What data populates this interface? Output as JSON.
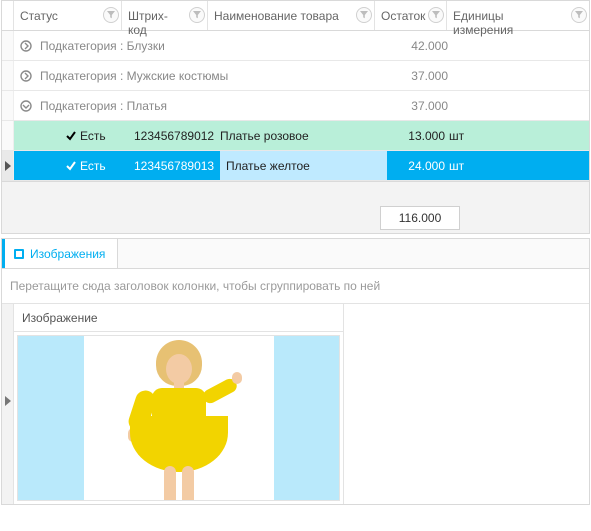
{
  "grid": {
    "columns": {
      "status": "Статус",
      "barcode": "Штрих-код",
      "name": "Наименование товара",
      "stock": "Остаток",
      "uom": "Единицы измерения"
    },
    "groups": [
      {
        "label": "Подкатегория : Блузки",
        "stock": "42.000",
        "expanded": false
      },
      {
        "label": "Подкатегория : Мужские костюмы",
        "stock": "37.000",
        "expanded": false
      },
      {
        "label": "Подкатегория : Платья",
        "stock": "37.000",
        "expanded": true
      }
    ],
    "rows": [
      {
        "status": "Есть",
        "barcode": "123456789012",
        "name": "Платье розовое",
        "stock": "13.000",
        "uom": "шт",
        "style": "green"
      },
      {
        "status": "Есть",
        "barcode": "123456789013",
        "name": "Платье желтое",
        "stock": "24.000",
        "uom": "шт",
        "style": "blue"
      }
    ],
    "total": "116.000"
  },
  "panel": {
    "tab": "Изображения",
    "group_hint": "Перетащите сюда заголовок колонки, чтобы сгруппировать по ней",
    "image_col": "Изображение"
  }
}
